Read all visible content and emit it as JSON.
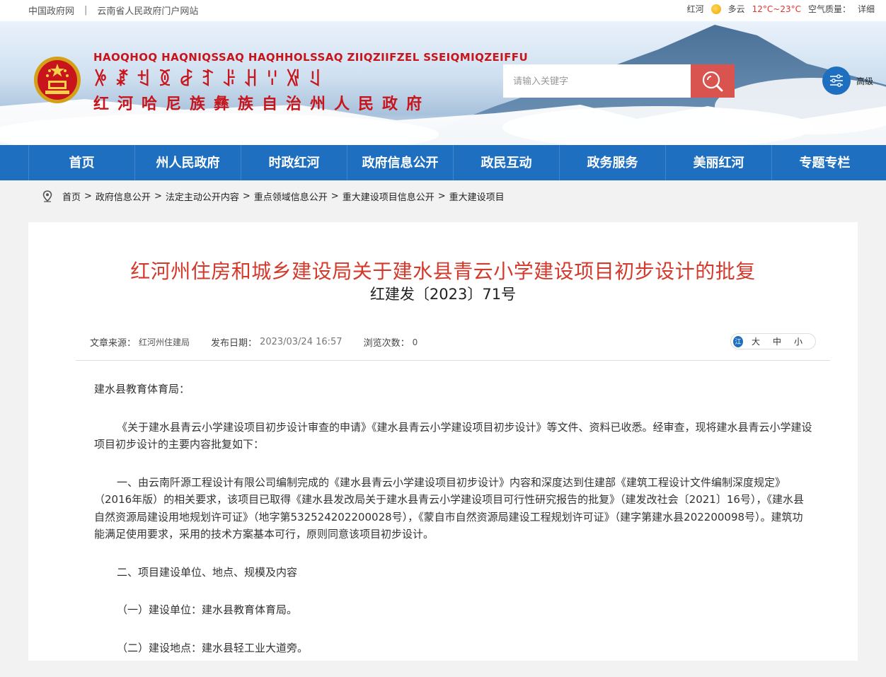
{
  "topbar": {
    "link_gov": "中国政府网",
    "separator": "|",
    "link_yunnan": "云南省人民政府门户网站",
    "weather_city": "红河",
    "weather_desc": "多云",
    "weather_temp": "12°C~23°C",
    "weather_extra": "空气质量：",
    "weather_more": "详细"
  },
  "banner": {
    "pinyin": "HAOQHOQ HAQNIQSSAQ HAQHHOLSSAQ ZIIQZIIFZEL SSEIQMIQZEIFFU",
    "yi": "ꉼꊨꉬꅉꆀꆈꌠꃅꈌꑟꆹ",
    "name_cn": "红河哈尼族彝族自治州人民政府"
  },
  "search": {
    "placeholder": "请输入关键字",
    "advanced_label": "高级"
  },
  "nav": {
    "items": [
      "首页",
      "州人民政府",
      "时政红河",
      "政府信息公开",
      "政民互动",
      "政务服务",
      "美丽红河",
      "专题专栏"
    ]
  },
  "breadcrumb": {
    "items": [
      "首页",
      "政府信息公开",
      "法定主动公开内容",
      "重点领域信息公开",
      "重大建设项目信息公开",
      "重大建设项目"
    ],
    "gt": ">"
  },
  "article": {
    "title": "红河州住房和城乡建设局关于建水县青云小学建设项目初步设计的批复",
    "doc_no": "红建发〔2023〕71号",
    "meta": {
      "source_label": "文章来源：",
      "source_value": "红河州住建局",
      "date_label": "发布日期：",
      "date_value": "2023/03/24 16:57",
      "views_label": "浏览次数：",
      "views_value": "0"
    },
    "font_size": {
      "logo": "江",
      "large": "大",
      "medium": "中",
      "small": "小"
    },
    "paragraphs": [
      "建水县教育体育局：",
      "《关于建水县青云小学建设项目初步设计审查的申请》《建水县青云小学建设项目初步设计》等文件、资料已收悉。经审查，现将建水县青云小学建设项目初步设计的主要内容批复如下：",
      "一、由云南阡源工程设计有限公司编制完成的《建水县青云小学建设项目初步设计》内容和深度达到住建部《建筑工程设计文件编制深度规定》（2016年版）的相关要求，该项目已取得《建水县发改局关于建水县青云小学建设项目可行性研究报告的批复》（建发改社会〔2021〕16号），《建水县自然资源局建设用地规划许可证》（地字第532524202200028号），《蒙自市自然资源局建设工程规划许可证》（建字第建水县202200098号）。建筑功能满足使用要求，采用的技术方案基本可行，原则同意该项目初步设计。",
      "二、项目建设单位、地点、规模及内容",
      "（一）建设单位：建水县教育体育局。",
      "（二）建设地点：建水县轻工业大道旁。"
    ]
  },
  "colors": {
    "brand_red": "#c8141b",
    "nav_blue": "#1f6fc0",
    "title_red": "#d33a2c",
    "search_btn": "#d9534f"
  }
}
